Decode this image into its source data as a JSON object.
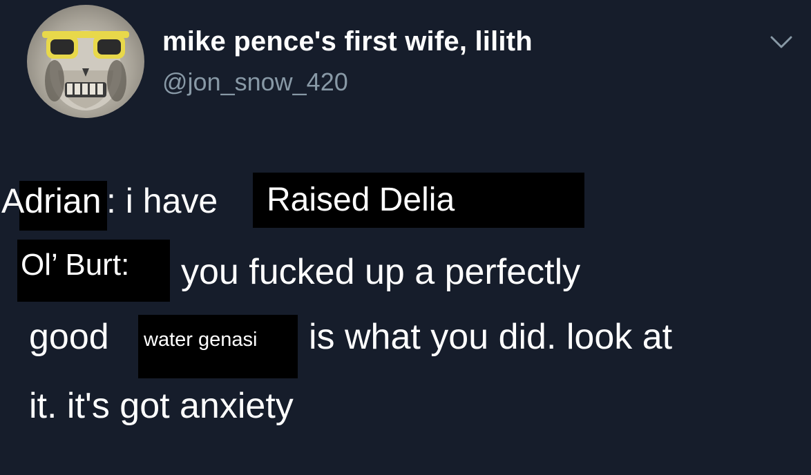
{
  "tweet": {
    "display_name": "mike pence's first wife, lilith",
    "handle": "@jon_snow_420",
    "avatar_icon": "avatar-skull-sunglasses-icon",
    "menu_icon": "chevron-down-icon",
    "lines": [
      {
        "speaker": "Adrian",
        "text_after_speaker": ": i have",
        "boxed_phrase": "Raised Delia"
      },
      {
        "speaker": "Ol’ Burt:",
        "text": "you fucked up a perfectly"
      },
      {
        "text_before": "good",
        "boxed_phrase": "water genasi",
        "text_after": "is what you did. look at"
      },
      {
        "text": "it. it's got anxiety"
      }
    ]
  },
  "colors": {
    "background": "#161d2b",
    "text": "#ffffff",
    "handle": "#8899a6",
    "redaction_box": "#000000"
  }
}
